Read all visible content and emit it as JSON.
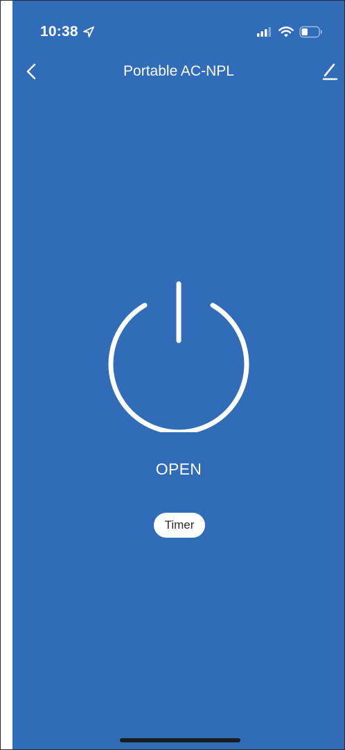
{
  "status_bar": {
    "time": "10:38",
    "icons": [
      "location-arrow-icon",
      "cellular-signal-icon",
      "wifi-icon",
      "battery-icon"
    ]
  },
  "nav": {
    "title": "Portable AC-NPL",
    "back_icon": "chevron-left-icon",
    "edit_icon": "pencil-icon"
  },
  "device": {
    "power_icon": "power-icon",
    "state": "OPEN",
    "timer_label": "Timer"
  },
  "colors": {
    "background": "#306cb7",
    "foreground": "#ffffff",
    "timer_text": "#2b2b2b"
  }
}
